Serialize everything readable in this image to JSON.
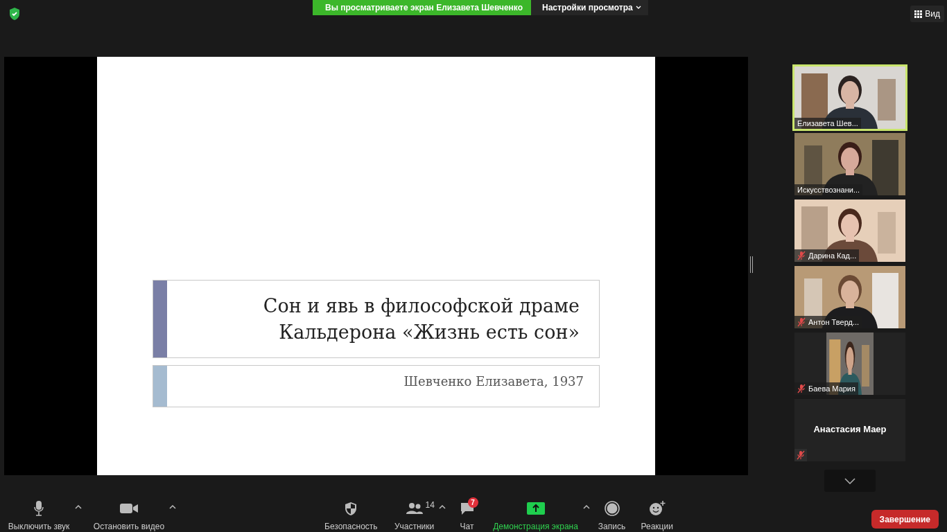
{
  "top_bar": {
    "banner": "Вы просматриваете экран Елизавета Шевченко",
    "view_options": "Настройки просмотра",
    "view_button": "Вид"
  },
  "shared_slide": {
    "title_lines": [
      "Сон и явь в философской драме",
      "Кальдерона «Жизнь есть сон»"
    ],
    "subtitle": "Шевченко Елизавета, 1937"
  },
  "participants": [
    {
      "name": "Елизавета Шев...",
      "kind": "video",
      "muted": false,
      "active": true
    },
    {
      "name": "Искусствознани...",
      "kind": "video",
      "muted": false,
      "active": false
    },
    {
      "name": "Дарина Кад...",
      "kind": "video",
      "muted": true,
      "active": false
    },
    {
      "name": "Антон Тверд...",
      "kind": "video",
      "muted": true,
      "active": false
    },
    {
      "name": "Баева Мария",
      "kind": "portrait",
      "muted": true,
      "active": false
    },
    {
      "name": "Анастасия Маер",
      "kind": "no-video",
      "muted": true,
      "active": false
    }
  ],
  "toolbar": [
    {
      "kind": "mic",
      "label": "Выключить звук",
      "menu": true,
      "active": false
    },
    {
      "kind": "camera",
      "label": "Остановить видео",
      "menu": true,
      "active": false
    },
    {
      "kind": "security",
      "label": "Безопасность",
      "menu": false,
      "active": false
    },
    {
      "kind": "participants",
      "label": "Участники",
      "count": "14",
      "menu": true,
      "active": false
    },
    {
      "kind": "chat",
      "label": "Чат",
      "badge": "7",
      "menu": false,
      "active": false
    },
    {
      "kind": "share",
      "label": "Демонстрация экрана",
      "menu": true,
      "active": true
    },
    {
      "kind": "record",
      "label": "Запись",
      "menu": false,
      "active": false
    },
    {
      "kind": "reactions",
      "label": "Реакции",
      "menu": false,
      "active": false
    }
  ],
  "end_button": "Завершение"
}
